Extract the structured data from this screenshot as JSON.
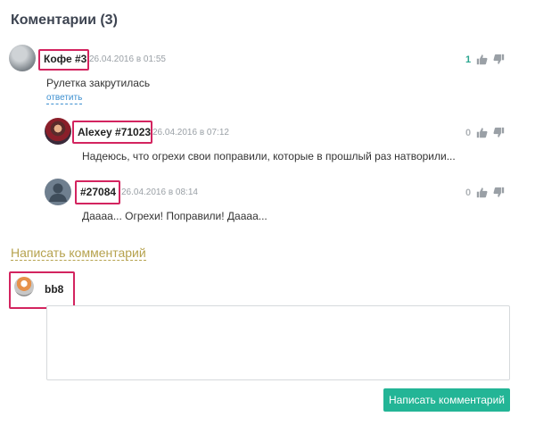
{
  "section": {
    "title": "Коментарии (3)"
  },
  "comments": [
    {
      "author": "Кофе #3",
      "date": "26.04.2016 в 01:55",
      "text": "Рулетка закрутилась",
      "reply_label": "ответить",
      "votes": "1"
    },
    {
      "author": "Alexey #71023",
      "date": "26.04.2016 в 07:12",
      "text": "Надеюсь, что огрехи свои поправили, которые в прошлый раз натворили...",
      "votes": "0"
    },
    {
      "author": "#27084",
      "date": "26.04.2016 в 08:14",
      "text": "Даааа... Огрехи! Поправили! Даааа...",
      "votes": "0"
    }
  ],
  "compose": {
    "title": "Написать комментарий",
    "username": "bb8",
    "textarea_value": "",
    "submit_label": "Написать комментарий"
  },
  "colors": {
    "highlight": "#d3245f",
    "accent": "#23b596",
    "link": "#3c8fd0",
    "compose_title": "#b6a24e",
    "positive_vote": "#2aa58f"
  },
  "icons": [
    "thumb-up-icon",
    "thumb-down-icon",
    "user-placeholder-icon"
  ]
}
